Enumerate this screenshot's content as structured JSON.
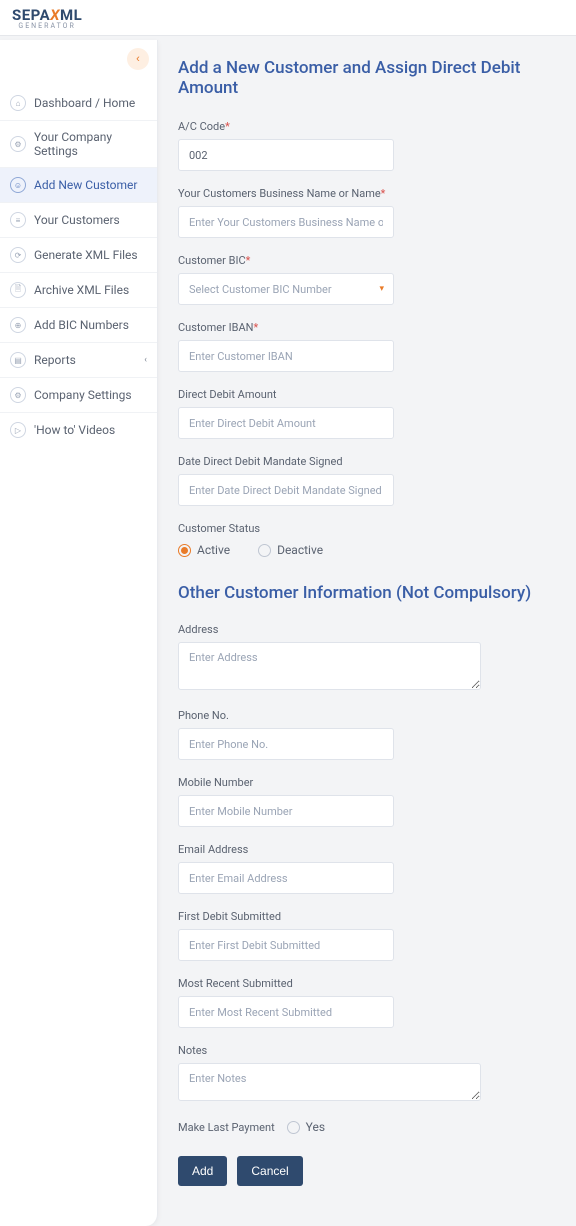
{
  "logo": {
    "prefix": "SEPA",
    "accent": "X",
    "suffix": "ML",
    "sub": "GENERATOR"
  },
  "sidebar": {
    "collapse_glyph": "‹",
    "items": [
      {
        "label": "Dashboard / Home",
        "glyph": "⌂"
      },
      {
        "label": "Your Company Settings",
        "glyph": "⚙"
      },
      {
        "label": "Add New Customer",
        "glyph": "☺",
        "active": true
      },
      {
        "label": "Your Customers",
        "glyph": "≡"
      },
      {
        "label": "Generate XML Files",
        "glyph": "⟳"
      },
      {
        "label": "Archive XML Files",
        "glyph": "🗎"
      },
      {
        "label": "Add BIC Numbers",
        "glyph": "⊕"
      },
      {
        "label": "Reports",
        "glyph": "▤",
        "expandable": true
      },
      {
        "label": "Company Settings",
        "glyph": "⚙"
      },
      {
        "label": "'How to' Videos",
        "glyph": "▷"
      }
    ]
  },
  "form": {
    "heading": "Add a New Customer and Assign Direct Debit Amount",
    "ac_code": {
      "label": "A/C Code",
      "required": true,
      "value": "002"
    },
    "business_name": {
      "label": "Your Customers Business Name or Name",
      "required": true,
      "placeholder": "Enter Your Customers Business Name or Name"
    },
    "bic": {
      "label": "Customer BIC",
      "required": true,
      "placeholder": "Select Customer BIC Number"
    },
    "iban": {
      "label": "Customer IBAN",
      "required": true,
      "placeholder": "Enter Customer IBAN"
    },
    "debit_amount": {
      "label": "Direct Debit Amount",
      "placeholder": "Enter Direct Debit Amount"
    },
    "mandate_date": {
      "label": "Date Direct Debit Mandate Signed",
      "placeholder": "Enter Date Direct Debit Mandate Signed"
    },
    "status": {
      "label": "Customer Status",
      "active": "Active",
      "deactive": "Deactive",
      "value": "active"
    },
    "other_heading": "Other Customer Information (Not Compulsory)",
    "address": {
      "label": "Address",
      "placeholder": "Enter Address"
    },
    "phone": {
      "label": "Phone No.",
      "placeholder": "Enter Phone No."
    },
    "mobile": {
      "label": "Mobile Number",
      "placeholder": "Enter Mobile Number"
    },
    "email": {
      "label": "Email Address",
      "placeholder": "Enter Email Address"
    },
    "first_debit": {
      "label": "First Debit Submitted",
      "placeholder": "Enter First Debit Submitted"
    },
    "recent_submitted": {
      "label": "Most Recent Submitted",
      "placeholder": "Enter Most Recent Submitted"
    },
    "notes": {
      "label": "Notes",
      "placeholder": "Enter Notes"
    },
    "last_payment": {
      "label": "Make Last Payment",
      "yes": "Yes"
    },
    "add_btn": "Add",
    "cancel_btn": "Cancel"
  }
}
